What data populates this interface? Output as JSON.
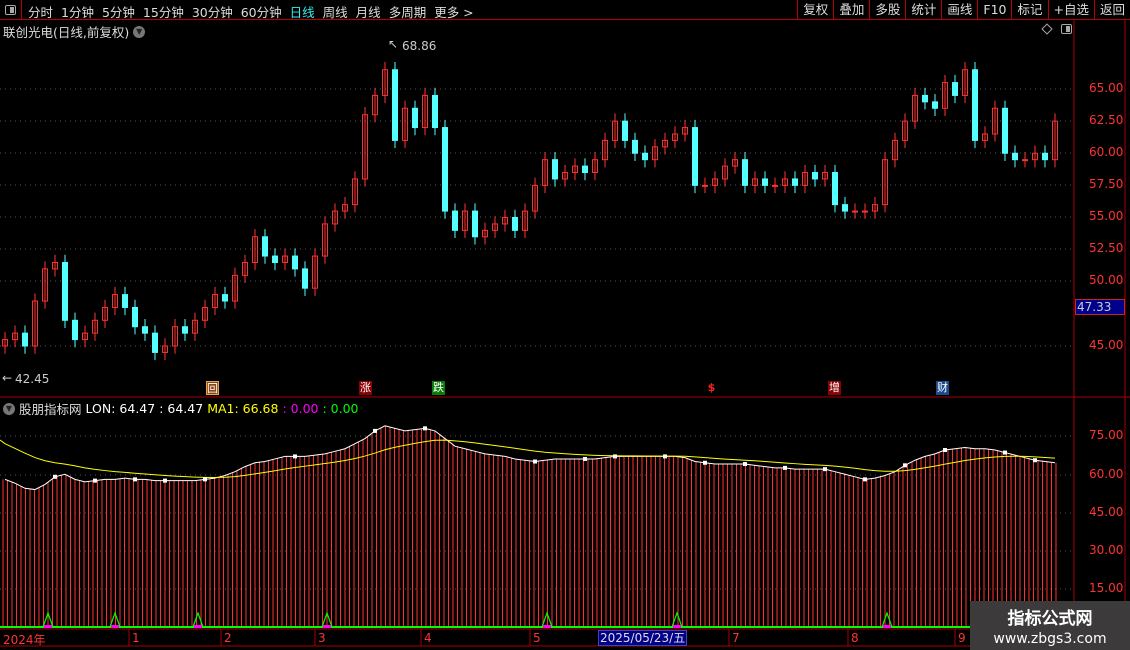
{
  "toolbar": {
    "periods": [
      "分时",
      "1分钟",
      "5分钟",
      "15分钟",
      "30分钟",
      "60分钟",
      "日线",
      "周线",
      "月线",
      "多周期",
      "更多 >"
    ],
    "active_period": "日线",
    "buttons": [
      "复权",
      "叠加",
      "多股",
      "统计",
      "画线",
      "F10",
      "标记",
      "+自选",
      "返回"
    ]
  },
  "chart_title": "联创光电(日线,前复权)",
  "colors": {
    "up": "#ff3232",
    "down": "#54ffff",
    "axis": "#ff3333",
    "grid": "#aa0000",
    "lon": "#ffffff",
    "ma1": "#ffff00",
    "signal": "#00ff00"
  },
  "price_axis": {
    "ticks": [
      "65.00",
      "62.50",
      "60.00",
      "57.50",
      "55.00",
      "52.50",
      "50.00",
      "45.00"
    ],
    "current_price": "47.33"
  },
  "annotations": {
    "high": "68.86",
    "low": "42.45"
  },
  "event_markers": [
    {
      "label": "回",
      "color": "#8b4513"
    },
    {
      "label": "涨",
      "color": "#8b0000"
    },
    {
      "label": "跌",
      "color": "#0a7a0a"
    },
    {
      "label": "$",
      "color": "#ff2020"
    },
    {
      "label": "增",
      "color": "#8b0000"
    },
    {
      "label": "财",
      "color": "#1a4a8a"
    }
  ],
  "indicator": {
    "name": "股朋指标网",
    "lon_label": "LON: 64.47",
    "lon_value2": ": 64.47",
    "ma1_label": "MA1: 66.68",
    "v3": ": 0.00",
    "v4": ": 0.00",
    "ticks": [
      "75.00",
      "60.00",
      "45.00",
      "30.00",
      "15.00"
    ]
  },
  "x_axis": {
    "labels": [
      "2024年",
      "1",
      "2",
      "3",
      "4",
      "5",
      "7",
      "8",
      "9"
    ],
    "cursor_date": "2025/05/23/五"
  },
  "watermark": {
    "title": "指标公式网",
    "url": "www.zbgs3.com"
  },
  "chart_data": {
    "type": "candlestick",
    "closes": [
      45.5,
      46,
      45,
      48.5,
      51,
      51.5,
      47,
      45.5,
      46,
      47,
      48,
      49,
      48,
      46.5,
      46,
      44.5,
      45,
      46.5,
      46,
      47,
      48,
      49,
      48.5,
      50.5,
      51.5,
      53.5,
      52,
      51.5,
      52,
      51,
      49.5,
      52,
      54.5,
      55.5,
      56,
      58,
      63,
      64.5,
      66.5,
      61,
      63.5,
      62,
      64.5,
      62,
      55.5,
      54,
      55.5,
      53.5,
      54,
      54.5,
      55,
      54,
      55.5,
      57.5,
      59.5,
      58,
      58.5,
      59,
      58.5,
      59.5,
      61,
      62.5,
      61,
      60,
      59.5,
      60.5,
      61,
      61.5,
      62,
      57.5,
      57.5,
      58,
      59,
      59.5,
      57.5,
      58,
      57.5,
      57.5,
      58,
      57.5,
      58.5,
      58,
      58.5,
      56,
      55.5,
      55.5,
      55.5,
      56,
      59.5,
      61,
      62.5,
      64.5,
      64,
      63.5,
      65.5,
      64.5,
      66.5,
      61,
      61.5,
      63.5,
      60,
      59.5,
      59.5,
      60,
      59.5,
      62.5
    ],
    "lon": [
      58,
      56.5,
      54.5,
      54,
      56,
      59,
      60,
      58,
      57,
      57.5,
      58,
      58,
      58.5,
      58,
      58,
      57.5,
      57.5,
      57.5,
      57.5,
      57.5,
      58,
      58.5,
      59.5,
      61,
      63,
      64.5,
      65,
      66,
      67,
      67,
      67,
      67.5,
      68,
      69,
      70,
      72,
      74,
      77,
      79,
      78,
      77,
      77.5,
      78,
      77,
      74,
      71,
      70,
      69,
      68,
      67.5,
      67,
      66,
      65.5,
      65,
      65.5,
      66,
      66,
      66,
      66,
      66,
      66.5,
      67,
      67,
      67,
      67,
      67,
      67,
      67,
      66.5,
      65,
      64.5,
      64,
      64,
      64,
      64,
      63.5,
      63,
      62.5,
      62.5,
      62,
      62,
      62,
      62,
      61,
      60,
      59,
      58,
      58.5,
      59.5,
      61,
      63.5,
      65.5,
      67,
      68,
      69.5,
      70,
      70.5,
      70,
      70,
      69.5,
      68.5,
      67.5,
      66.5,
      65.5,
      65,
      64.5
    ],
    "ma1_last": 66.68,
    "price_range": [
      41.5,
      70.5
    ],
    "indicator_range": [
      5,
      90
    ]
  }
}
